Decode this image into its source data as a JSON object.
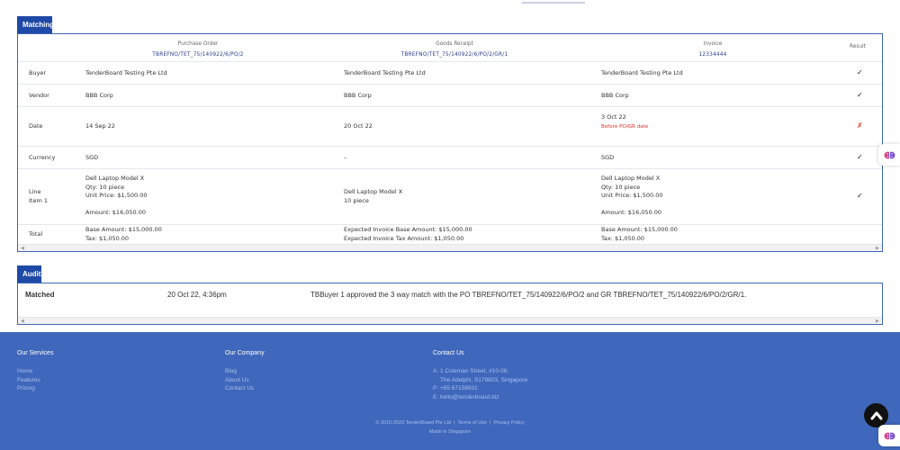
{
  "matching": {
    "tab_label": "Matching",
    "headers": {
      "po_label": "Purchase Order",
      "po_number": "TBREFNO/TET_75/140922/6/PO/2",
      "gr_label": "Goods Receipt",
      "gr_number": "TBREFNO/TET_75/140922/6/PO/2/GR/1",
      "inv_label": "Invoice",
      "inv_number": "12334444",
      "result_label": "Result"
    },
    "rows": [
      {
        "label": "Buyer",
        "po": "TenderBoard Testing Pte Ltd",
        "gr": "TenderBoard Testing Pte Ltd",
        "inv": "TenderBoard Testing Pte Ltd",
        "result": "✓"
      },
      {
        "label": "Vendor",
        "po": "BBB Corp",
        "gr": "BBB Corp",
        "inv": "BBB Corp",
        "result": "✓"
      },
      {
        "label": "Date",
        "po": "14 Sep 22",
        "gr": "20 Oct 22",
        "inv": "3 Oct 22",
        "inv_note": "Before PO/GR date",
        "result": "✗"
      },
      {
        "label": "Currency",
        "po": "SGD",
        "gr": "–",
        "inv": "SGD",
        "result": "✓"
      },
      {
        "label_line1": "Line",
        "label_line2": "Item 1",
        "po_name": "Dell Laptop Model X",
        "po_qty": "Qty: 10 piece",
        "po_price": "Unit Price: $1,500.00",
        "po_amount": "Amount: $16,050.00",
        "gr_name": "Dell Laptop Model X",
        "gr_qty": "10 piece",
        "inv_name": "Dell Laptop Model X",
        "inv_qty": "Qty: 10 piece",
        "inv_price": "Unit Price: $1,500.00",
        "inv_amount": "Amount: $16,050.00",
        "result": "✓"
      },
      {
        "label": "Total",
        "po_base": "Base Amount: $15,000.00",
        "po_tax": "Tax: $1,050.00",
        "gr_base": "Expected Invoice Base Amount: $15,000.00",
        "gr_tax": "Expected Invoice Tax Amount: $1,050.00",
        "inv_base": "Base Amount: $15,000.00",
        "inv_tax": "Tax: $1,050.00"
      }
    ]
  },
  "audit": {
    "tab_label": "Audit",
    "entries": [
      {
        "status": "Matched",
        "time": "20 Oct 22, 4:36pm",
        "message": "TBBuyer 1 approved the 3 way match with the PO TBREFNO/TET_75/140922/6/PO/2 and GR TBREFNO/TET_75/140922/6/PO/2/GR/1."
      }
    ]
  },
  "footer": {
    "services": {
      "title": "Our Services",
      "links": [
        "Home",
        "Features",
        "Pricing"
      ]
    },
    "company": {
      "title": "Our Company",
      "links": [
        "Blog",
        "About Us",
        "Contact Us"
      ]
    },
    "contact": {
      "title": "Contact Us",
      "address1": "A: 1 Coleman Street, #10-06,",
      "address2": "The Adelphi, S179803, Singapore",
      "phone": "P: +65 67158931",
      "email": "E: hello@tenderboard.biz"
    },
    "copyright": "© 2015-2023 TenderBoard Pte Ltd",
    "terms": "Terms of Use",
    "privacy": "Privacy Policy",
    "made_in": "Made in Singapore"
  },
  "colors": {
    "brand": "#1f49a7",
    "footer": "#3f67bb",
    "error": "#e0312b"
  },
  "icons": {
    "result_pass": "check-icon",
    "result_fail": "cross-icon",
    "assistant": "brain-icon",
    "back_to_top": "chevron-up-icon"
  }
}
